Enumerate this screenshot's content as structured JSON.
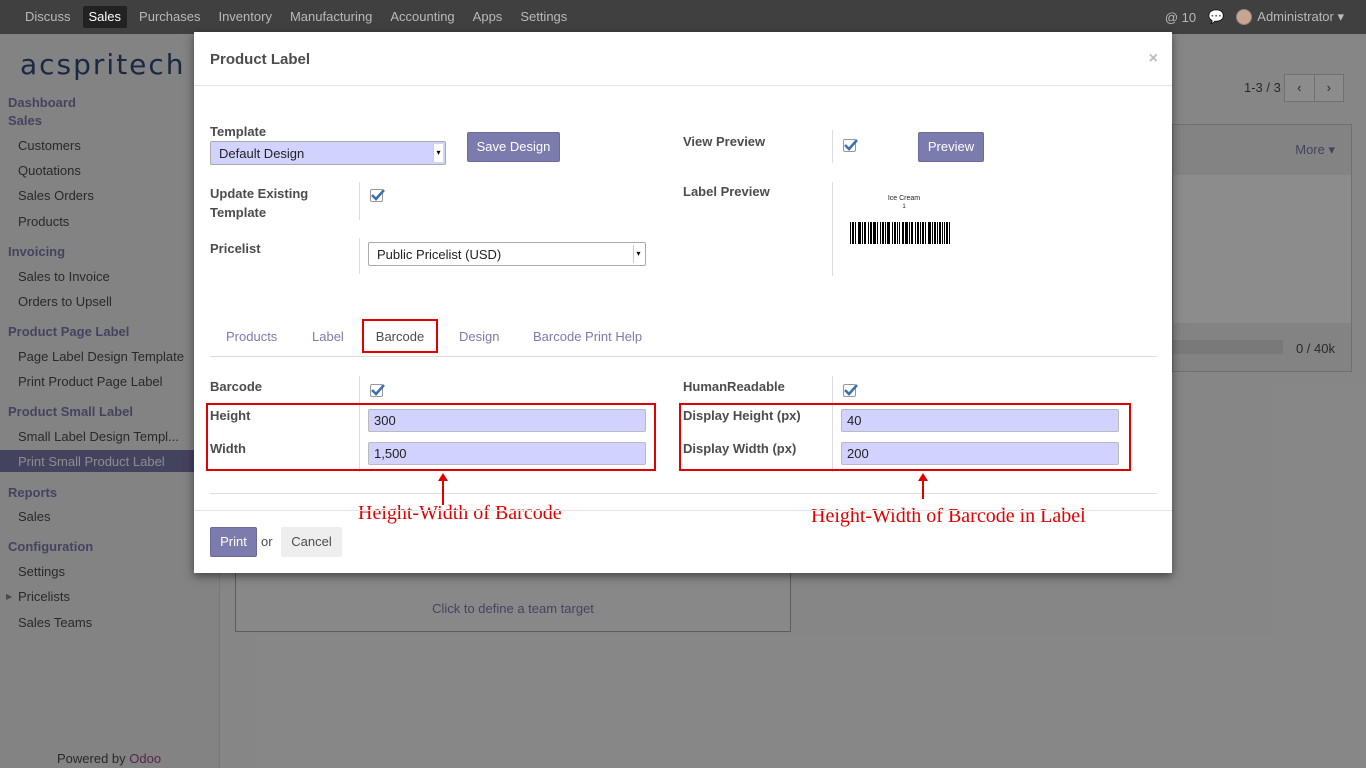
{
  "topbar": {
    "menu": [
      "Discuss",
      "Sales",
      "Purchases",
      "Inventory",
      "Manufacturing",
      "Accounting",
      "Apps",
      "Settings"
    ],
    "active": "Sales",
    "notif_count": "@ 10",
    "user": "Administrator ▾"
  },
  "sidebar": {
    "logo": "acspritech",
    "sections": [
      {
        "title": "Dashboard"
      },
      {
        "title": "Sales",
        "items": [
          "Customers",
          "Quotations",
          "Sales Orders",
          "Products"
        ]
      },
      {
        "title": "Invoicing",
        "items": [
          "Sales to Invoice",
          "Orders to Upsell"
        ]
      },
      {
        "title": "Product Page Label",
        "items": [
          "Page Label Design Template",
          "Print Product Page Label"
        ]
      },
      {
        "title": "Product Small Label",
        "items": [
          "Small Label Design Templ...",
          "Print Small Product Label"
        ]
      },
      {
        "title": "Reports",
        "items": [
          "Sales"
        ]
      },
      {
        "title": "Configuration",
        "items": [
          "Settings",
          "Pricelists",
          "Sales Teams"
        ]
      }
    ],
    "powered_prefix": "Powered by",
    "powered_brand": "Odoo"
  },
  "background": {
    "pager": "1-3 / 3",
    "more": "More ▾",
    "progress": "0 / 40k",
    "team_target": "Click to define a team target"
  },
  "modal": {
    "title": "Product Label",
    "close": "×",
    "template_label": "Template",
    "template_value": "Default Design",
    "save_design": "Save Design",
    "view_preview_label": "View Preview",
    "preview_button": "Preview",
    "update_label": "Update Existing Template",
    "label_preview_label": "Label Preview",
    "preview_product": "Ice Cream",
    "preview_qty": "1",
    "pricelist_label": "Pricelist",
    "pricelist_value": "Public Pricelist (USD)",
    "tabs": [
      "Products",
      "Label",
      "Barcode",
      "Design",
      "Barcode Print Help"
    ],
    "active_tab": "Barcode",
    "barcode_label": "Barcode",
    "human_label": "HumanReadable",
    "height_label": "Height",
    "height_value": "300",
    "width_label": "Width",
    "width_value": "1,500",
    "disp_height_label": "Display Height (px)",
    "disp_height_value": "40",
    "disp_width_label": "Display Width (px)",
    "disp_width_value": "200",
    "print": "Print",
    "or": "or",
    "cancel": "Cancel"
  },
  "annotations": {
    "left": "Height-Width of Barcode",
    "right": "Height-Width of Barcode in Label",
    "color": "#e00000"
  }
}
